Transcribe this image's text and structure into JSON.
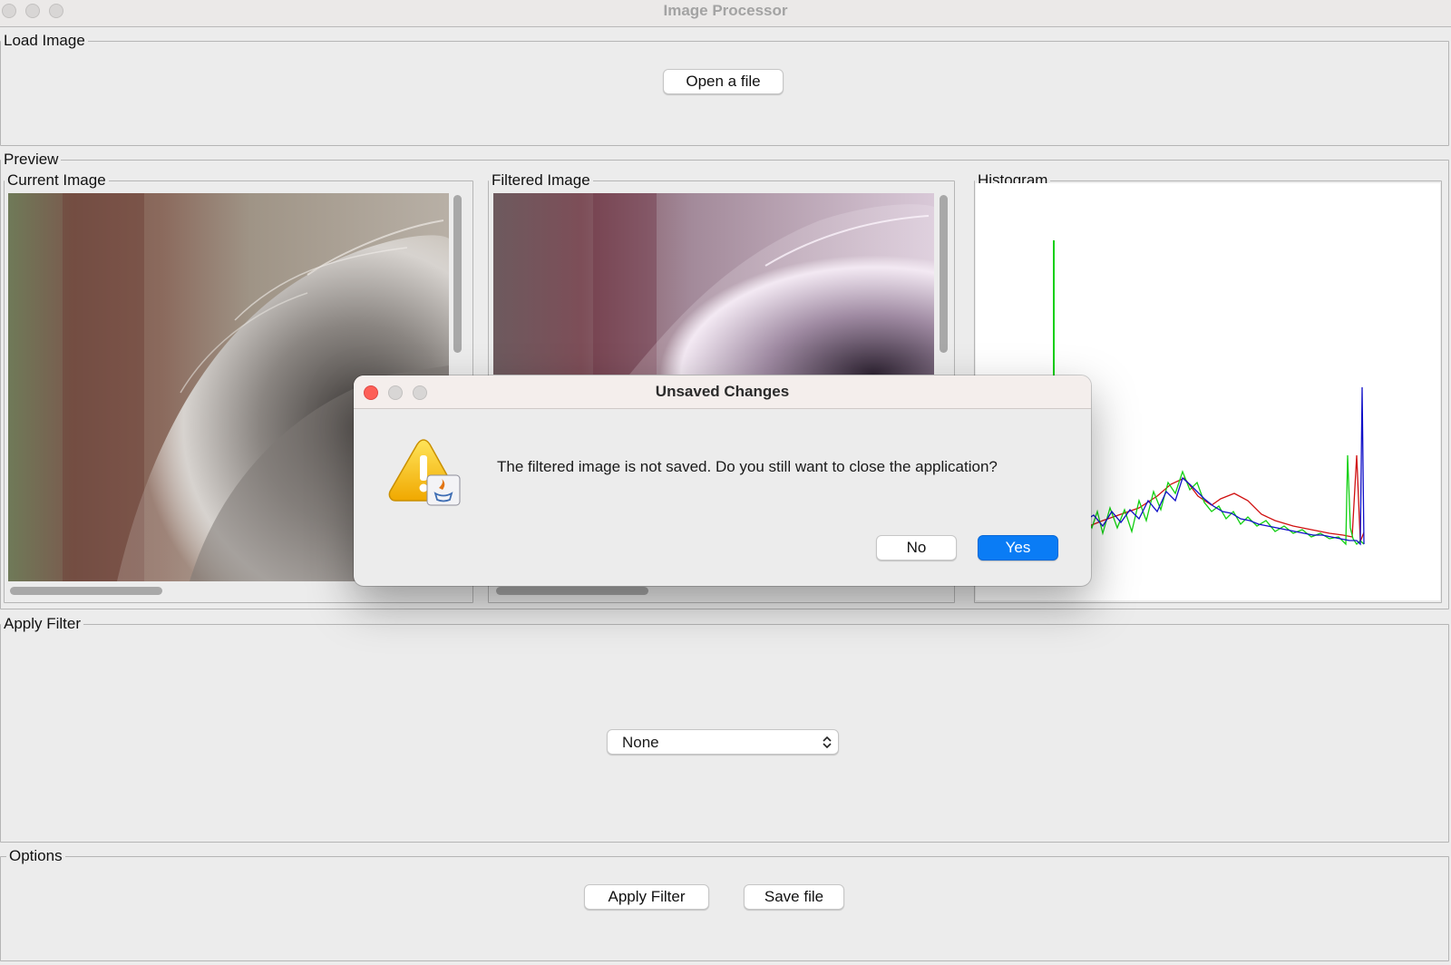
{
  "window": {
    "title": "Image Processor"
  },
  "load_image": {
    "legend": "Load Image",
    "open_button": "Open a file"
  },
  "preview": {
    "legend": "Preview",
    "current_image": {
      "legend": "Current Image"
    },
    "filtered_image": {
      "legend": "Filtered Image"
    },
    "histogram": {
      "legend": "Histogram",
      "series_colors": {
        "red": "#d01010",
        "green": "#10d010",
        "blue": "#1010c8"
      }
    }
  },
  "apply_filter": {
    "legend": "Apply Filter",
    "filter_select_value": "None"
  },
  "options": {
    "legend": "Options",
    "apply_button": "Apply Filter",
    "save_button": "Save file"
  },
  "dialog": {
    "title": "Unsaved Changes",
    "message": "The filtered image is not saved. Do you still want to close the application?",
    "no_button": "No",
    "yes_button": "Yes",
    "accent_color": "#0a7cf5"
  }
}
